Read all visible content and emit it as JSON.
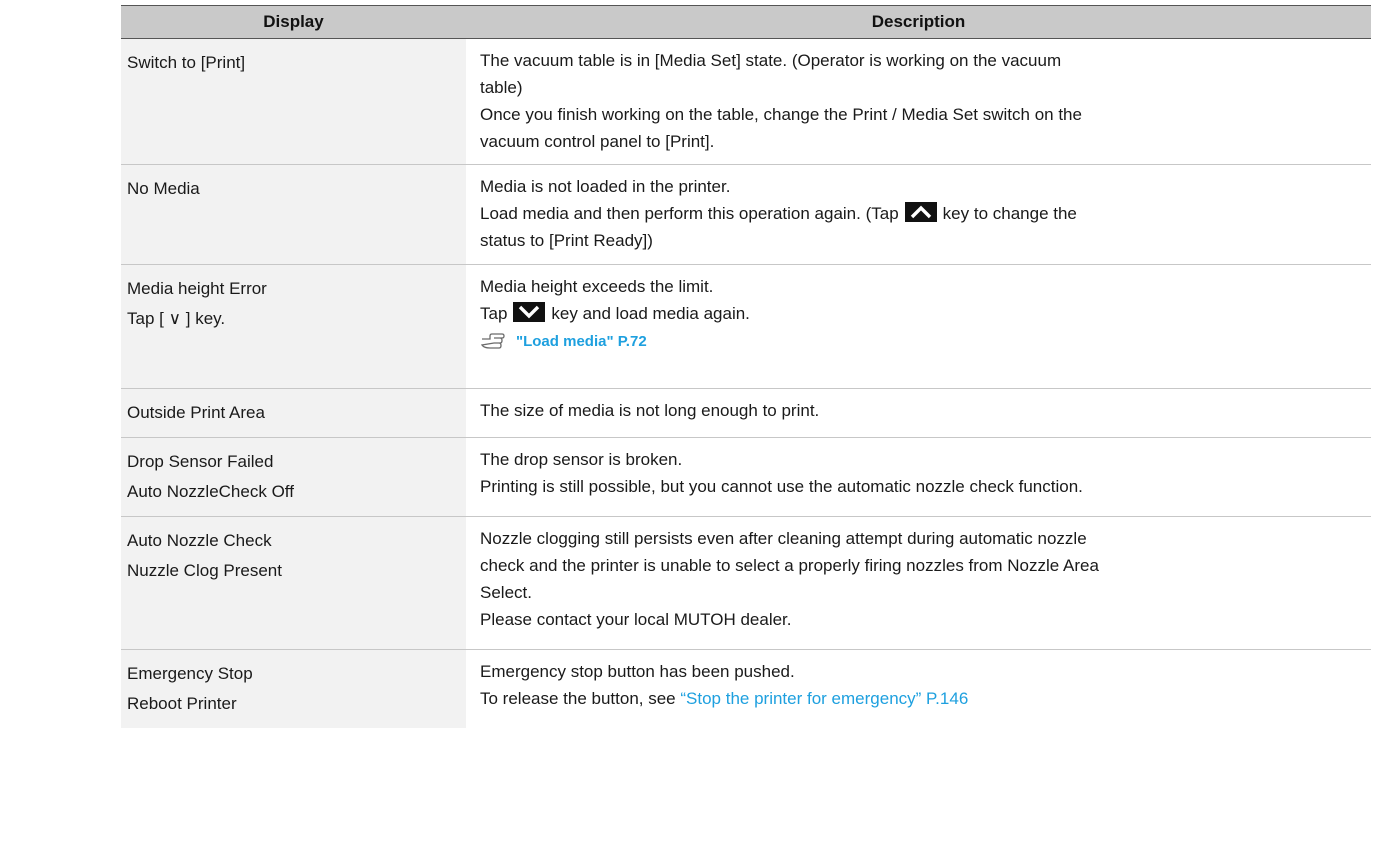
{
  "header": {
    "display": "Display",
    "description": "Description"
  },
  "rows": [
    {
      "display": [
        "Switch to [Print]"
      ],
      "description": {
        "l1": "The vacuum table is in [Media Set] state. (Operator is working on the vacuum",
        "l2": "table)",
        "l3": "Once you finish working on the table, change the Print / Media Set switch on the",
        "l4": "vacuum control panel to [Print]."
      }
    },
    {
      "display": [
        "No Media"
      ],
      "description": {
        "l1": "Media is not loaded in the printer.",
        "l2_pre": "Load media and then perform this operation again. (Tap",
        "l2_post": "key to change the",
        "l3": "status to [Print Ready])"
      }
    },
    {
      "display": [
        "Media height Error",
        "Tap [ ∨ ] key."
      ],
      "description": {
        "l1": "Media height exceeds the limit.",
        "l2_pre": "Tap",
        "l2_post": "key and load media again.",
        "ref": "\"Load media\" P.72"
      }
    },
    {
      "display": [
        "Outside Print Area"
      ],
      "description": {
        "l1": "The size of media is not long enough to print."
      }
    },
    {
      "display": [
        "Drop Sensor Failed",
        "Auto NozzleCheck Off"
      ],
      "description": {
        "l1": "The drop sensor is broken.",
        "l2": "Printing is still possible, but you cannot use the automatic nozzle check function."
      }
    },
    {
      "display": [
        "Auto Nozzle Check",
        "Nuzzle Clog Present"
      ],
      "description": {
        "l1": "Nozzle clogging still persists even after cleaning attempt during automatic nozzle",
        "l2": "check and the printer is unable to select a properly firing nozzles from Nozzle Area",
        "l3": "Select.",
        "l4": "Please contact your local MUTOH dealer."
      }
    },
    {
      "display": [
        "Emergency Stop",
        "Reboot Printer"
      ],
      "description": {
        "l1": "Emergency stop button has been pushed.",
        "l2_pre": "To release the button, see",
        "l2_link": "“Stop the printer for emergency” P.146"
      }
    }
  ],
  "colors": {
    "header_bg": "#c9c9c9",
    "display_bg": "#f2f2f2",
    "link": "#1ea0df",
    "key_bg": "#111111"
  },
  "icons": {
    "up_key": "chevron-up-key-icon",
    "down_key": "chevron-down-key-icon",
    "ref": "pointing-hand-icon"
  }
}
